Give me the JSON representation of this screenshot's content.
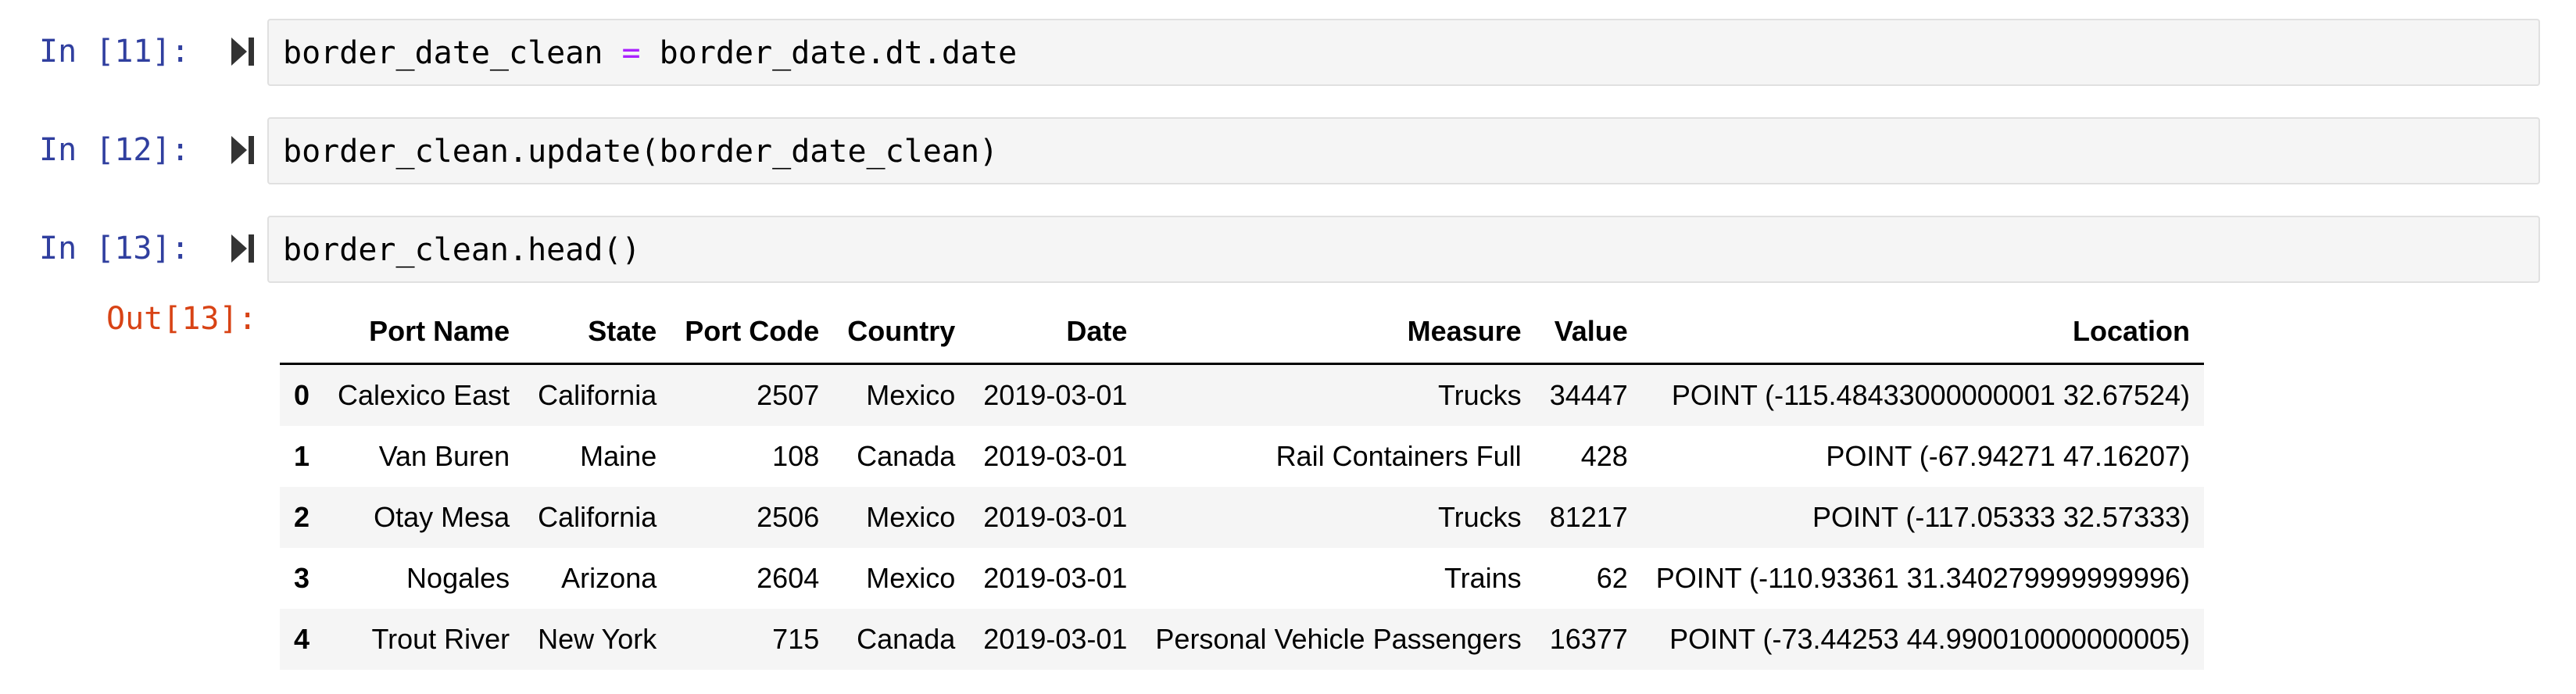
{
  "cells": [
    {
      "prompt": "In [11]:",
      "code_pre": "border_date_clean ",
      "code_op": "=",
      "code_post": " border_date.dt.date"
    },
    {
      "prompt": "In [12]:",
      "code": "border_clean.update(border_date_clean)"
    },
    {
      "prompt": "In [13]:",
      "code": "border_clean.head()"
    }
  ],
  "output": {
    "prompt": "Out[13]:",
    "columns": [
      "",
      "Port Name",
      "State",
      "Port Code",
      "Country",
      "Date",
      "Measure",
      "Value",
      "Location"
    ],
    "rows": [
      [
        "0",
        "Calexico East",
        "California",
        "2507",
        "Mexico",
        "2019-03-01",
        "Trucks",
        "34447",
        "POINT (-115.48433000000001 32.67524)"
      ],
      [
        "1",
        "Van Buren",
        "Maine",
        "108",
        "Canada",
        "2019-03-01",
        "Rail Containers Full",
        "428",
        "POINT (-67.94271 47.16207)"
      ],
      [
        "2",
        "Otay Mesa",
        "California",
        "2506",
        "Mexico",
        "2019-03-01",
        "Trucks",
        "81217",
        "POINT (-117.05333 32.57333)"
      ],
      [
        "3",
        "Nogales",
        "Arizona",
        "2604",
        "Mexico",
        "2019-03-01",
        "Trains",
        "62",
        "POINT (-110.93361 31.340279999999996)"
      ],
      [
        "4",
        "Trout River",
        "New York",
        "715",
        "Canada",
        "2019-03-01",
        "Personal Vehicle Passengers",
        "16377",
        "POINT (-73.44253 44.990010000000005)"
      ]
    ]
  },
  "icons": {
    "run": "run-cell-icon"
  },
  "colors": {
    "prompt_in": "#303f9f",
    "prompt_out": "#d84315",
    "operator": "#aa22ff",
    "input_bg": "#f5f5f5"
  }
}
